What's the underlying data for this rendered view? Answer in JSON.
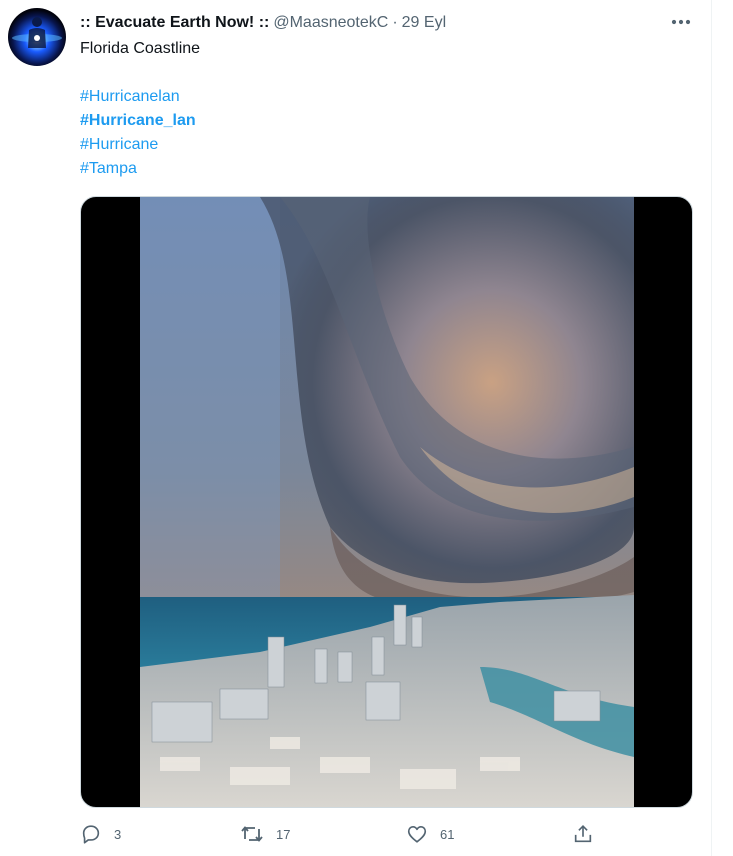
{
  "tweet": {
    "author_name": ":: Evacuate Earth Now! ::",
    "handle": "@MaasneotekC",
    "separator": "·",
    "date": "29 Eyl",
    "text": "Florida Coastline",
    "hashtags": [
      "#Hurricanelan",
      "#Hurricane_lan",
      "#Hurricane",
      "#Tampa"
    ]
  },
  "actions": {
    "reply_count": "3",
    "retweet_count": "17",
    "like_count": "61"
  },
  "icons": {
    "more": "more-horizontal-icon",
    "reply": "reply-icon",
    "retweet": "retweet-icon",
    "like": "heart-icon",
    "share": "share-icon"
  },
  "colors": {
    "link": "#1d9bf0",
    "secondary_text": "#536471",
    "primary_text": "#0f1419"
  }
}
